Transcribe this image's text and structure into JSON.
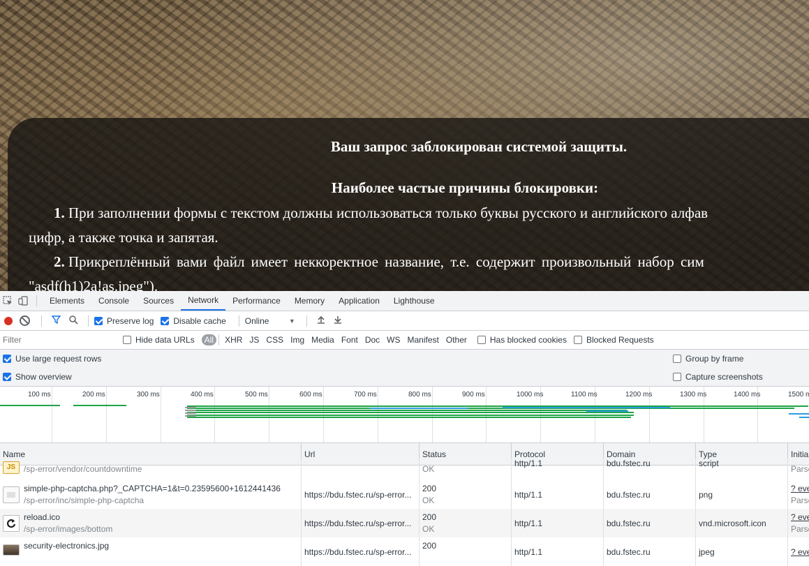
{
  "notice": {
    "title": "Ваш запрос заблокирован системой защиты.",
    "subtitle": "Наиболее частые причины блокировки:",
    "p1_num": "1.",
    "p1_line1": "При заполнении формы с текстом должны использоваться только буквы русского и английского алфав",
    "p1_line2": "цифр, а также точка и запятая.",
    "p2_num": "2.",
    "p2_line1": "Прикреплённый  вами  файл  имеет  неккоректное  название,  т.е.  содержит  произвольный  набор  сим",
    "p2_line2": "\"asdf(h1)2a!as.jpeg\")."
  },
  "devtools": {
    "tabs": [
      "Elements",
      "Console",
      "Sources",
      "Network",
      "Performance",
      "Memory",
      "Application",
      "Lighthouse"
    ],
    "active_tab": "Network",
    "toolbar": {
      "preserve_log": "Preserve log",
      "disable_cache": "Disable cache",
      "throttle": "Online"
    },
    "filter": {
      "placeholder": "Filter",
      "hide_data_urls": "Hide data URLs",
      "types": [
        "All",
        "XHR",
        "JS",
        "CSS",
        "Img",
        "Media",
        "Font",
        "Doc",
        "WS",
        "Manifest",
        "Other"
      ],
      "has_blocked_cookies": "Has blocked cookies",
      "blocked_requests": "Blocked Requests"
    },
    "options": {
      "large_rows": "Use large request rows",
      "show_overview": "Show overview",
      "group_by_frame": "Group by frame",
      "capture_screenshots": "Capture screenshots"
    },
    "overview_ticks": [
      "100 ms",
      "200 ms",
      "300 ms",
      "400 ms",
      "500 ms",
      "600 ms",
      "700 ms",
      "800 ms",
      "900 ms",
      "1000 ms",
      "1100 ms",
      "1200 ms",
      "1300 ms",
      "1400 ms",
      "1500 ms"
    ],
    "columns": [
      "Name",
      "Url",
      "Status",
      "Protocol",
      "Domain",
      "Type",
      "Initia"
    ],
    "rows": [
      {
        "name": "",
        "path": "/sp-error/vendor/countdowntime",
        "url": "",
        "status": "",
        "status_text": "OK",
        "protocol": "http/1.1",
        "domain": "bdu.fstec.ru",
        "type": "script",
        "initiator": "",
        "initiator_sub": "Parse",
        "icon": "js-file-icon"
      },
      {
        "name": "simple-php-captcha.php?_CAPTCHA=1&t=0.23595600+1612441436",
        "path": "/sp-error/inc/simple-php-captcha",
        "url": "https://bdu.fstec.ru/sp-error...",
        "status": "200",
        "status_text": "OK",
        "protocol": "http/1.1",
        "domain": "bdu.fstec.ru",
        "type": "png",
        "initiator": "? eve",
        "initiator_sub": "Parse",
        "icon": "image-icon"
      },
      {
        "name": "reload.ico",
        "path": "/sp-error/images/bottom",
        "url": "https://bdu.fstec.ru/sp-error...",
        "status": "200",
        "status_text": "OK",
        "protocol": "http/1.1",
        "domain": "bdu.fstec.ru",
        "type": "vnd.microsoft.icon",
        "initiator": "? eve",
        "initiator_sub": "Parse",
        "icon": "reload-icon"
      },
      {
        "name": "security-electronics.jpg",
        "path": "",
        "url": "https://bdu.fstec.ru/sp-error...",
        "status": "200",
        "status_text": "",
        "protocol": "http/1.1",
        "domain": "bdu.fstec.ru",
        "type": "jpeg",
        "initiator": "? eve",
        "initiator_sub": "",
        "icon": "photo-icon"
      }
    ]
  }
}
